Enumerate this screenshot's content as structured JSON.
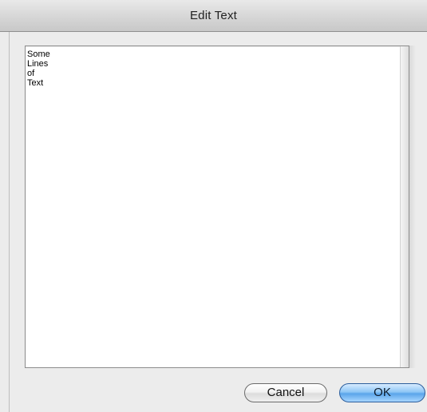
{
  "window": {
    "title": "Edit Text"
  },
  "editor": {
    "text": "Some\nLines\nof\nText"
  },
  "buttons": {
    "cancel_label": "Cancel",
    "ok_label": "OK"
  },
  "colors": {
    "window_background": "#ececec",
    "default_button": "#5aa5ea"
  }
}
